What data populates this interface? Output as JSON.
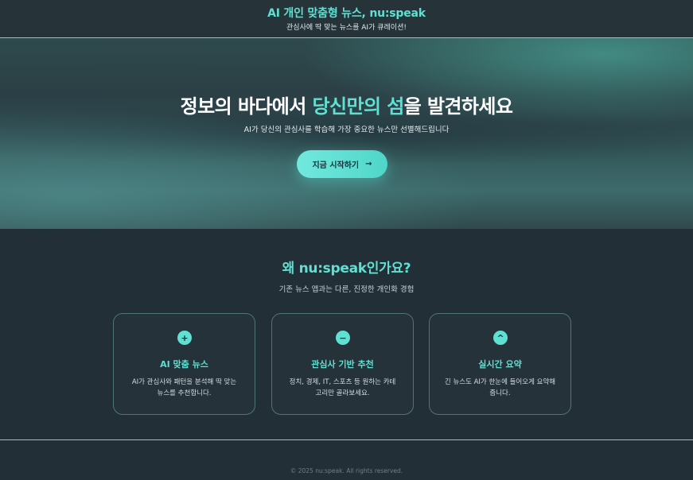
{
  "header": {
    "brand": "AI 개인 맞춤형 뉴스, nu:speak",
    "tagline": "관심사에 딱 맞는 뉴스를 AI가 큐레이션!"
  },
  "hero": {
    "title_before": "정보의 바다에서 ",
    "title_highlight": "당신만의 섬",
    "title_after": "을 발견하세요",
    "subtitle": "AI가 당신의 관심사를 학습해 가장 중요한 뉴스만 선별해드립니다",
    "cta_label": "지금 시작하기",
    "cta_icon": "→"
  },
  "why": {
    "title": "왜 nu:speak인가요?",
    "subtitle": "기존 뉴스 앱과는 다른, 진정한 개인화 경험"
  },
  "features": [
    {
      "icon": "plus-icon",
      "glyph": "+",
      "title": "AI 맞춤 뉴스",
      "desc": "AI가 관심사와 패턴을 분석해 딱 맞는 뉴스를 추천합니다."
    },
    {
      "icon": "minus-icon",
      "glyph": "−",
      "title": "관심사 기반 추천",
      "desc": "정치, 경제, IT, 스포츠 등 원하는 카테고리만 골라보세요."
    },
    {
      "icon": "caret-up-icon",
      "glyph": "^",
      "title": "실시간 요약",
      "desc": "긴 뉴스도 AI가 한눈에 들어오게 요약해 줍니다."
    }
  ],
  "footer": {
    "copyright": "© 2025 nu:speak. All rights reserved."
  },
  "colors": {
    "accent": "#5fe0d2",
    "background": "#232f37"
  }
}
